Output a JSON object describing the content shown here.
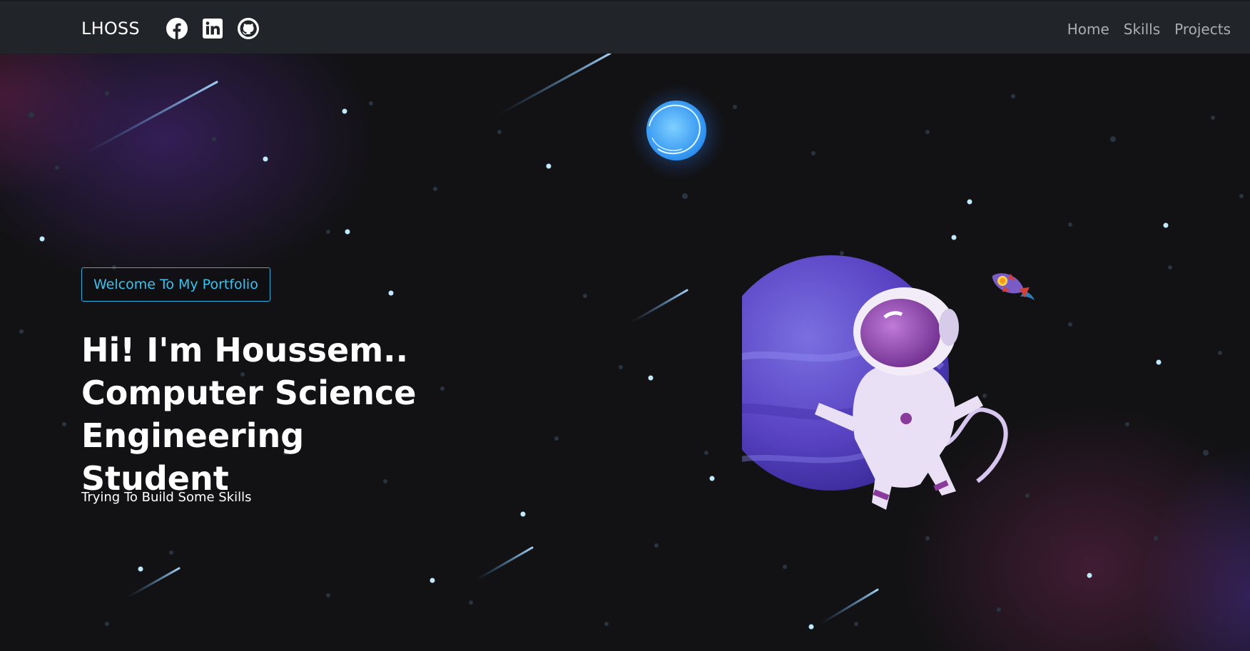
{
  "nav": {
    "brand": "LHOSS",
    "social_icons": [
      "facebook-icon",
      "linkedin-icon",
      "github-icon"
    ],
    "links": [
      "Home",
      "Skills",
      "Projects"
    ]
  },
  "hero": {
    "tagline": "Welcome To My Portfolio",
    "title_lines": [
      "Hi! I'm Houssem..",
      "Computer Science Engineering",
      "Student"
    ],
    "subtitle": "Trying To Build Some Skills"
  },
  "colors": {
    "navbar_bg": "#212529",
    "page_bg": "#121214",
    "accent": "#39c3f2",
    "nav_link": "rgba(255,255,255,0.62)"
  }
}
